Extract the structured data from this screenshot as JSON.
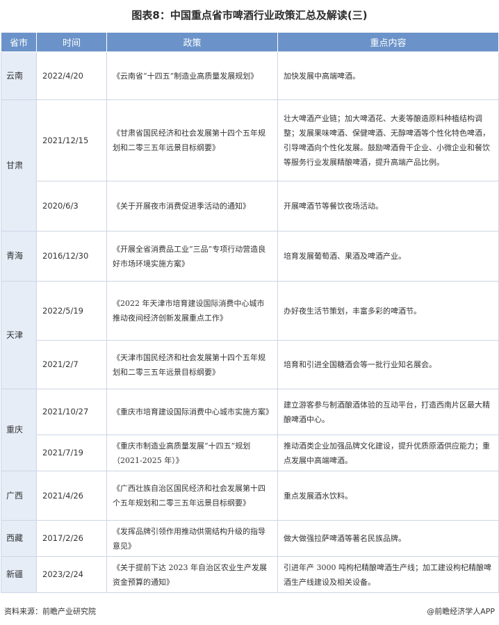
{
  "title": "图表8：中国重点省市啤酒行业政策汇总及解读(三)",
  "headers": {
    "province": "省市",
    "time": "时间",
    "policy": "政策",
    "content": "重点内容"
  },
  "rows": [
    {
      "province": "云南",
      "time": "2022/4/20",
      "policy": "《云南省“十四五”制造业高质量发展规划》",
      "content": "加快发展中高端啤酒。"
    },
    {
      "province": "甘肃",
      "time": "2021/12/15",
      "policy": "《甘肃省国民经济和社会发展第十四个五年规划和二零三五年远景目标纲要》",
      "content": "壮大啤酒产业链；加大啤酒花、大麦等酿造原料种植结构调整；发展果味啤酒、保健啤酒、无醇啤酒等个性化特色啤酒，引导啤酒向个性化发展。鼓励啤酒骨干企业、小微企业和餐饮等服务行业发展精酿啤酒，提升高端产品比例。"
    },
    {
      "province": "",
      "time": "2020/6/3",
      "policy": "《关于开展夜市消费促进季活动的通知》",
      "content": "开展啤酒节等餐饮夜场活动。"
    },
    {
      "province": "青海",
      "time": "2016/12/30",
      "policy": "《开展全省消费品工业“三品”专项行动营造良好市场环境实施方案》",
      "content": "培育发展葡萄酒、果酒及啤酒产业。"
    },
    {
      "province": "天津",
      "time": "2022/5/19",
      "policy": "《2022 年天津市培育建设国际消费中心城市推动夜间经济创新发展重点工作》",
      "content": "办好夜生活节策划，丰富多彩的啤酒节。"
    },
    {
      "province": "",
      "time": "2021/2/7",
      "policy": "《天津市国民经济和社会发展第十四个五年规划和二零三五年远景目标纲要》",
      "content": "培育和引进全国糖酒会等一批行业知名展会。"
    },
    {
      "province": "重庆",
      "time": "2021/10/27",
      "policy": "《重庆市培育建设国际消费中心城市实施方案》",
      "content": "建立游客参与制酒酿酒体验的互动平台，打造西南片区最大精酿啤酒中心。"
    },
    {
      "province": "",
      "time": "2021/7/19",
      "policy": "《重庆市制造业高质量发展“十四五”规划（2021-2025 年）》",
      "content": "推动酒类企业加强品牌文化建设，提升优质原酒供应能力；重点发展中高端啤酒。"
    },
    {
      "province": "广西",
      "time": "2021/4/26",
      "policy": "《广西壮族自治区国民经济和社会发展第十四个五年规划和二零三五年远景目标纲要》",
      "content": "重点发展酒水饮料。"
    },
    {
      "province": "西藏",
      "time": "2017/2/26",
      "policy": "《发挥品牌引领作用推动供需结构升级的指导意见》",
      "content": "做大做强拉萨啤酒等著名民族品牌。"
    },
    {
      "province": "新疆",
      "time": "2023/2/24",
      "policy": "《关于提前下达 2023 年自治区农业生产发展资金预算的通知》",
      "content": "引进年产 3000 吨枸杞精酿啤酒生产线；加工建设枸杞精酿啤酒生产线建设及相关设备。"
    }
  ],
  "footer": {
    "source": "资料来源：前瞻产业研究院",
    "app": "@前瞻经济学人APP"
  }
}
